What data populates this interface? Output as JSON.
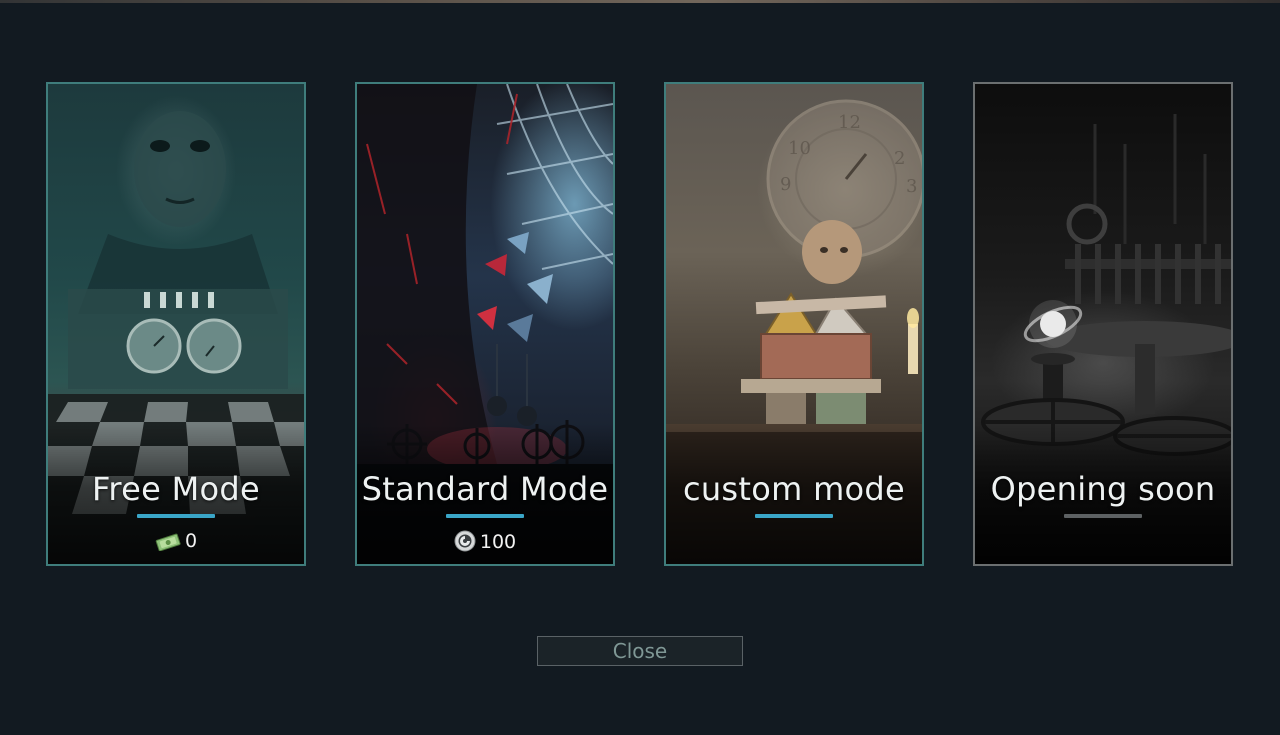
{
  "modes": [
    {
      "title": "Free Mode",
      "cost": "0",
      "cost_icon": "cash-icon",
      "state": "available"
    },
    {
      "title": "Standard Mode",
      "cost": "100",
      "cost_icon": "coin-icon",
      "state": "available"
    },
    {
      "title": "custom mode",
      "state": "available"
    },
    {
      "title": "Opening soon",
      "state": "locked"
    }
  ],
  "close_label": "Close",
  "colors": {
    "background": "#121a21",
    "card_border": "#3f7d7c",
    "underline_active": "#3aa6c8",
    "underline_locked": "#5d6163",
    "close_text": "#7f9795"
  }
}
